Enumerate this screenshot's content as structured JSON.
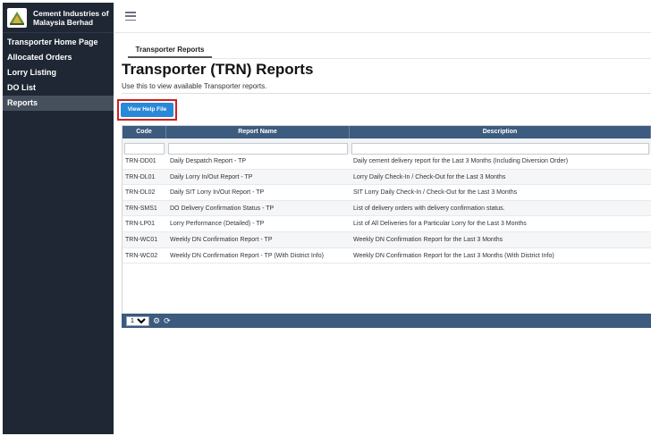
{
  "brand": {
    "name_line1": "Cement Industries of",
    "name_line2": "Malaysia Berhad"
  },
  "sidebar": {
    "items": [
      {
        "label": "Transporter Home Page"
      },
      {
        "label": "Allocated Orders"
      },
      {
        "label": "Lorry Listing"
      },
      {
        "label": "DO List"
      },
      {
        "label": "Reports"
      }
    ],
    "active": "Reports"
  },
  "topbar": {
    "menu_icon": "hamburger-icon"
  },
  "tab": {
    "label": "Transporter Reports"
  },
  "page": {
    "title": "Transporter (TRN) Reports",
    "subtitle": "Use this to view available Transporter reports."
  },
  "actions": {
    "help_label": "View Help File"
  },
  "table": {
    "columns": [
      "Code",
      "Report Name",
      "Description"
    ],
    "filters": {
      "code": "",
      "report_name": "",
      "description": ""
    },
    "rows": [
      {
        "code": "TRN-DD01",
        "name": "Daily Despatch Report - TP",
        "description": "Daily cement delivery report for the Last 3 Months (Including Diversion Order)"
      },
      {
        "code": "TRN-DL01",
        "name": "Daily Lorry In/Out Report - TP",
        "description": "Lorry Daily Check-In / Check-Out for the Last 3 Months"
      },
      {
        "code": "TRN-DL02",
        "name": "Daily SIT Lorry In/Out Report - TP",
        "description": "SIT Lorry Daily Check-In / Check-Out for the Last 3 Months"
      },
      {
        "code": "TRN-SMS1",
        "name": "DO Delivery Confirmation Status - TP",
        "description": "List of delivery orders with delivery confirmation status."
      },
      {
        "code": "TRN-LP01",
        "name": "Lorry Performance (Detailed) - TP",
        "description": "List of All Deliveries for a Particular Lorry for the Last 3 Months"
      },
      {
        "code": "TRN-WC01",
        "name": "Weekly DN Confirmation Report - TP",
        "description": "Weekly DN Confirmation Report for the Last 3 Months"
      },
      {
        "code": "TRN-WC02",
        "name": "Weekly DN Confirmation Report - TP (With District Info)",
        "description": "Weekly DN Confirmation Report for the Last 3 Months (With District Info)"
      }
    ]
  },
  "pager": {
    "page_size": "10",
    "page_size_options": [
      "10"
    ],
    "settings_icon": "gear-icon",
    "refresh_icon": "refresh-icon"
  },
  "colors": {
    "sidebar": "#1e2733",
    "header": "#3c5b7e",
    "button": "#2a88d8",
    "highlight": "#d21f1f"
  }
}
